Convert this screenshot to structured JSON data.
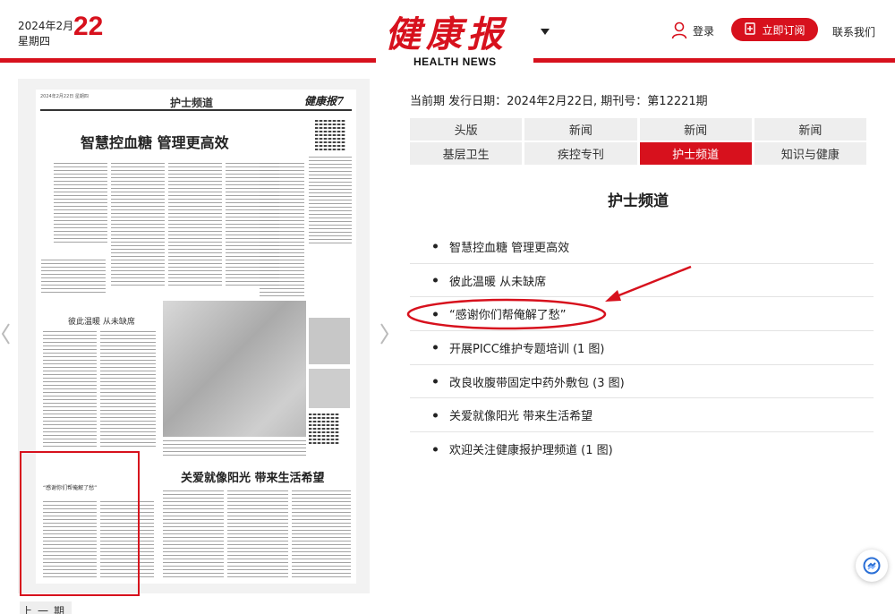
{
  "header": {
    "date_ym": "2024年2月",
    "weekday": "星期四",
    "day": "22",
    "logo": "健康报",
    "logo_sub": "HEALTH NEWS",
    "login_label": "登录",
    "subscribe_label": "立即订阅",
    "contact_label": "联系我们"
  },
  "colors": {
    "accent": "#d7111d"
  },
  "issue": {
    "text": "当前期 发行日期：2024年2月22日, 期刊号：第12221期"
  },
  "tabs": [
    {
      "label": "头版"
    },
    {
      "label": "新闻"
    },
    {
      "label": "新闻"
    },
    {
      "label": "新闻"
    },
    {
      "label": "基层卫生"
    },
    {
      "label": "疾控专刊"
    },
    {
      "label": "护士频道",
      "active": true
    },
    {
      "label": "知识与健康"
    }
  ],
  "section_title": "护士频道",
  "articles": [
    {
      "title": "智慧控血糖 管理更高效"
    },
    {
      "title": "彼此温暖 从未缺席"
    },
    {
      "title": "“感谢你们帮俺解了愁”"
    },
    {
      "title": "开展PICC维护专题培训 (1 图)"
    },
    {
      "title": "改良收腹带固定中药外敷包 (3 图)"
    },
    {
      "title": "关爱就像阳光 带来生活希望"
    },
    {
      "title": "欢迎关注健康报护理频道 (1 图)"
    }
  ],
  "paper": {
    "top_line": "2024年2月22日 星期四",
    "channel": "护士频道",
    "logo": "健康报7",
    "headline1": "智慧控血糖 管理更高效",
    "headline2": "彼此温暖 从未缺席",
    "headline3": "关爱就像阳光 带来生活希望",
    "box_title": "“感谢你们帮俺解了愁”"
  },
  "bottom_tab": "上一期"
}
